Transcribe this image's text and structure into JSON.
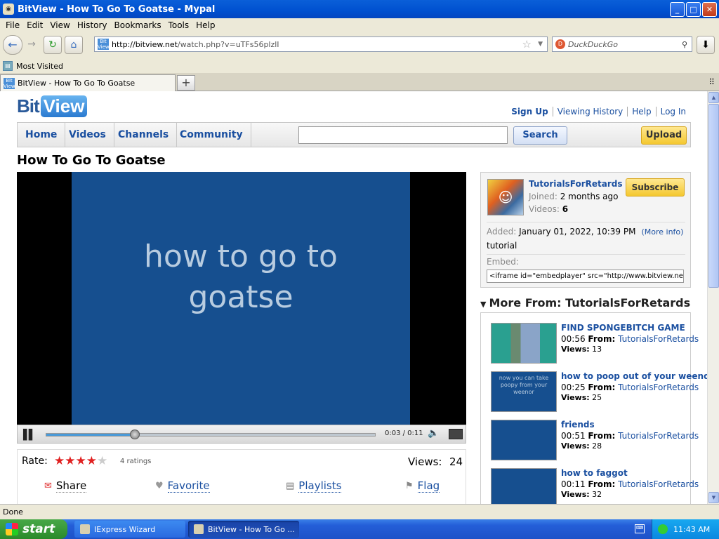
{
  "window": {
    "title": "BitView - How To Go To Goatse - Mypal",
    "min": "_",
    "max": "□",
    "close": "✕"
  },
  "menu": [
    "File",
    "Edit",
    "View",
    "History",
    "Bookmarks",
    "Tools",
    "Help"
  ],
  "nav": {
    "back": "←",
    "forward": "→",
    "reload": "↻",
    "home": "⌂",
    "url_domain": "http://bitview.net",
    "url_path": "/watch.php?v=uTFs56plzlI",
    "search_placeholder": "DuckDuckGo",
    "download": "⬇"
  },
  "bookmarks": {
    "item": "Most Visited"
  },
  "tab": {
    "title": "BitView - How To Go To Goatse",
    "new": "+"
  },
  "site": {
    "logo_bit": "Bit",
    "logo_view": "View",
    "toplinks": [
      "Sign Up",
      "Viewing History",
      "Help",
      "Log In"
    ],
    "navtabs": [
      "Home",
      "Videos",
      "Channels",
      "Community"
    ],
    "search_btn": "Search",
    "upload_btn": "Upload"
  },
  "video": {
    "title": "How To Go To Goatse",
    "screen_text_1": "how to go to",
    "screen_text_2": "goatse",
    "time": "0:03 / 0:11",
    "progress": 0.27
  },
  "rating": {
    "label": "Rate:",
    "stars": 4,
    "max_stars": 5,
    "count": "4 ratings",
    "views_label": "Views:",
    "views": "24"
  },
  "actions": {
    "share": "Share",
    "favorite": "Favorite",
    "playlists": "Playlists",
    "flag": "Flag"
  },
  "uploader": {
    "name": "TutorialsForRetards",
    "joined_k": "Joined:",
    "joined_v": "2 months ago",
    "videos_k": "Videos:",
    "videos_v": "6",
    "subscribe": "Subscribe",
    "added_k": "Added:",
    "added_v": "January 01, 2022, 10:39 PM",
    "more_info": "(More info)",
    "description": "tutorial",
    "embed_k": "Embed:",
    "embed_code": "<iframe id=\"embedplayer\" src=\"http://www.bitview.net/emb"
  },
  "more_from": {
    "heading": "More From: TutorialsForRetards",
    "items": [
      {
        "title": "FIND SPONGEBITCH GAME",
        "duration": "00:56",
        "from_k": "From:",
        "from": "TutorialsForRetards",
        "views_k": "Views:",
        "views": "13",
        "thumb_text": ""
      },
      {
        "title": "how to poop out of your weenor",
        "duration": "00:25",
        "from_k": "From:",
        "from": "TutorialsForRetards",
        "views_k": "Views:",
        "views": "25",
        "thumb_text": "now you can take poopy from your weenor"
      },
      {
        "title": "friends",
        "duration": "00:51",
        "from_k": "From:",
        "from": "TutorialsForRetards",
        "views_k": "Views:",
        "views": "28",
        "thumb_text": ""
      },
      {
        "title": "how to faggot",
        "duration": "00:11",
        "from_k": "From:",
        "from": "TutorialsForRetards",
        "views_k": "Views:",
        "views": "32",
        "thumb_text": ""
      }
    ]
  },
  "status": {
    "text": "Done"
  },
  "taskbar": {
    "start": "start",
    "task1": "IExpress Wizard",
    "task2": "BitView - How To Go ...",
    "clock": "11:43 AM"
  }
}
